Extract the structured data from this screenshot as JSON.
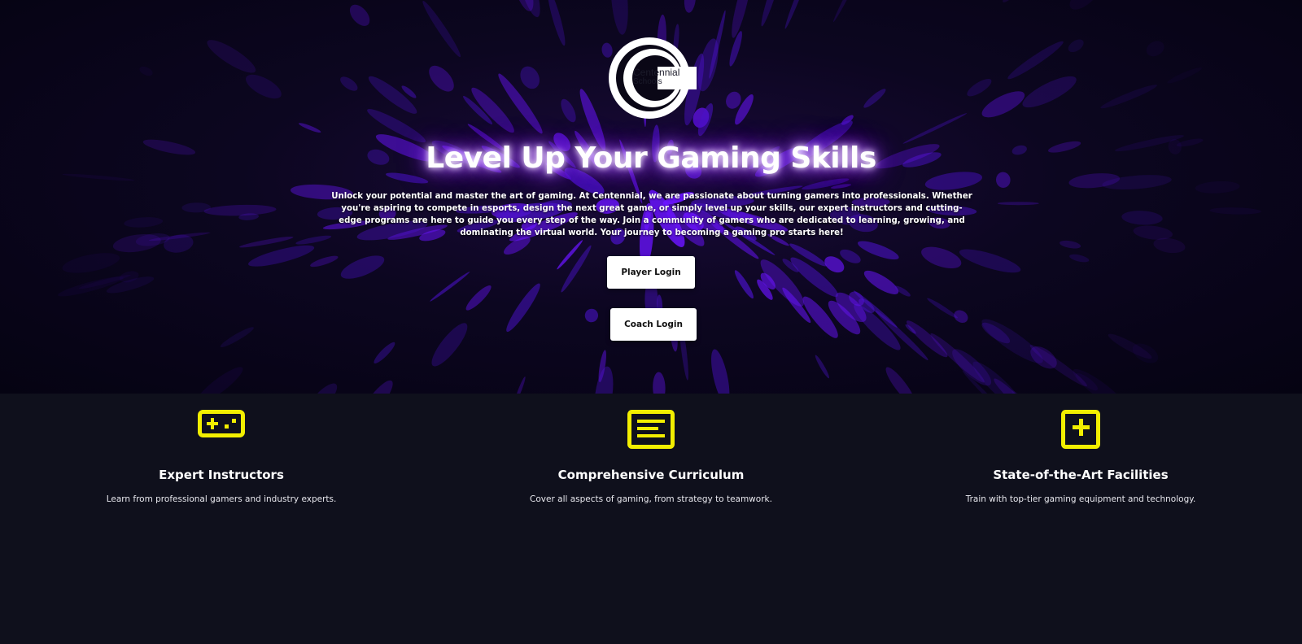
{
  "brand": {
    "logo_line1": "Centennial",
    "logo_line2": "Schools"
  },
  "hero": {
    "title": "Level Up Your Gaming Skills",
    "description": "Unlock your potential and master the art of gaming. At Centennial, we are passionate about turning gamers into professionals. Whether you're aspiring to compete in esports, design the next great game, or simply level up your skills, our expert instructors and cutting-edge programs are here to guide you every step of the way. Join a community of gamers who are dedicated to learning, growing, and dominating the virtual world. Your journey to becoming a gaming pro starts here!",
    "player_login_label": "Player Login",
    "coach_login_label": "Coach Login"
  },
  "features": [
    {
      "icon": "gamepad-icon",
      "title": "Expert Instructors",
      "text": "Learn from professional gamers and industry experts."
    },
    {
      "icon": "curriculum-icon",
      "title": "Comprehensive Curriculum",
      "text": "Cover all aspects of gaming, from strategy to teamwork."
    },
    {
      "icon": "plus-box-icon",
      "title": "State-of-the-Art Facilities",
      "text": "Train with top-tier gaming equipment and technology."
    }
  ],
  "colors": {
    "accent_yellow": "#f2ee00",
    "hero_purple": "#6a14ff",
    "background": "#0f101c"
  }
}
